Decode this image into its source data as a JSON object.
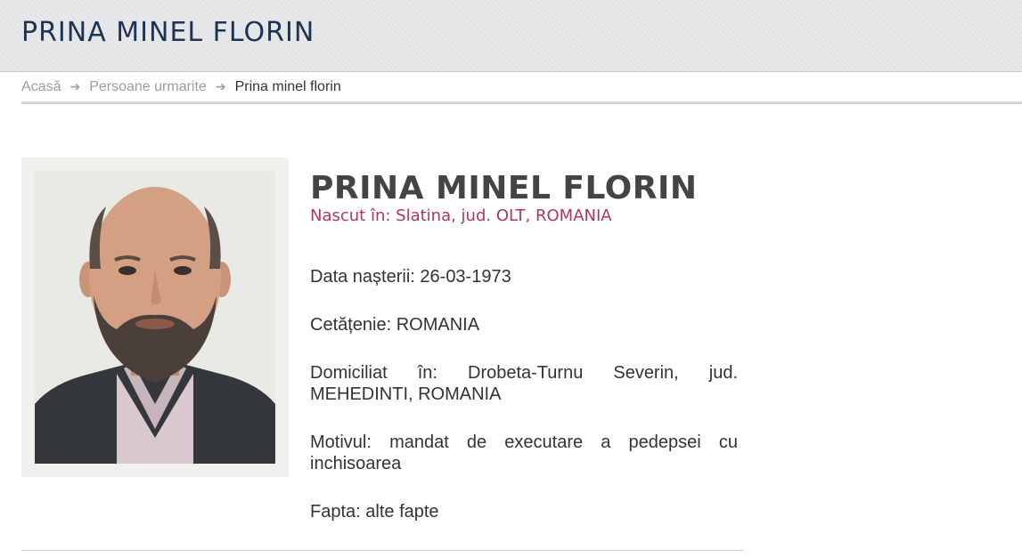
{
  "header": {
    "title": "PRINA MINEL FLORIN"
  },
  "breadcrumb": {
    "items": [
      {
        "label": "Acasă"
      },
      {
        "label": "Persoane urmarite"
      },
      {
        "label": "Prina minel florin"
      }
    ],
    "separator": "➔"
  },
  "person": {
    "name": "PRINA MINEL FLORIN",
    "birthplace": "Nascut în: Slatina, jud. OLT, ROMANIA",
    "fields": [
      {
        "label": "Data nașterii:",
        "value": "26-03-1973"
      },
      {
        "label": "Cetățenie:",
        "value": "ROMANIA"
      },
      {
        "label": "Domiciliat în:",
        "value": "Drobeta-Turnu Severin, jud. MEHEDINTI, ROMANIA"
      },
      {
        "label": "Motivul:",
        "value": "mandat de executare a pedepsei cu inchisoarea"
      },
      {
        "label": "Fapta:",
        "value": "alte fapte"
      }
    ]
  },
  "colors": {
    "header_title": "#1d3455",
    "birthplace": "#b3374f",
    "name": "#444444",
    "breadcrumb_link": "#9a9ea3"
  }
}
